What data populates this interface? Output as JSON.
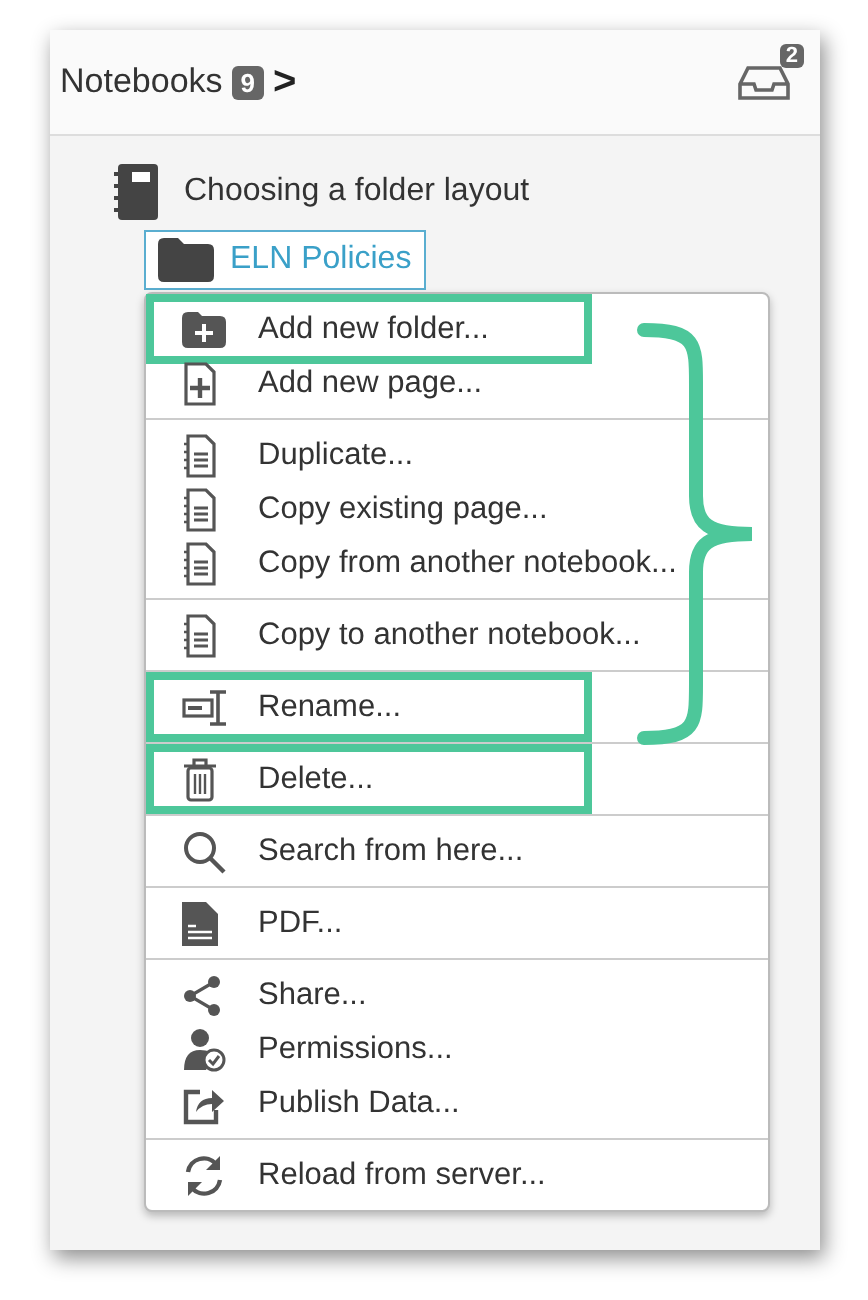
{
  "header": {
    "title": "Notebooks",
    "count": "9",
    "chevron": ">",
    "inbox_badge": "2"
  },
  "tree": {
    "notebook": "Choosing a folder layout",
    "folder": {
      "label": "ELN Policies",
      "selected": true
    }
  },
  "menu": {
    "groups": [
      [
        {
          "kind": "add-folder",
          "label": "Add new folder...",
          "highlighted": true
        },
        {
          "kind": "add-page",
          "label": "Add new page...",
          "highlighted": false
        }
      ],
      [
        {
          "kind": "page",
          "label": "Duplicate...",
          "highlighted": false
        },
        {
          "kind": "page",
          "label": "Copy existing page...",
          "highlighted": false
        },
        {
          "kind": "page",
          "label": "Copy from another notebook...",
          "highlighted": false
        }
      ],
      [
        {
          "kind": "page",
          "label": "Copy to another notebook...",
          "highlighted": false
        }
      ],
      [
        {
          "kind": "rename",
          "label": "Rename...",
          "highlighted": true
        }
      ],
      [
        {
          "kind": "trash",
          "label": "Delete...",
          "highlighted": true
        }
      ],
      [
        {
          "kind": "search",
          "label": "Search from here...",
          "highlighted": false
        }
      ],
      [
        {
          "kind": "pdf",
          "label": "PDF...",
          "highlighted": false
        }
      ],
      [
        {
          "kind": "share",
          "label": "Share...",
          "highlighted": false
        },
        {
          "kind": "permissions",
          "label": "Permissions...",
          "highlighted": false
        },
        {
          "kind": "publish",
          "label": "Publish Data...",
          "highlighted": false
        }
      ],
      [
        {
          "kind": "reload",
          "label": "Reload from server...",
          "highlighted": false
        }
      ]
    ]
  },
  "brace": true
}
